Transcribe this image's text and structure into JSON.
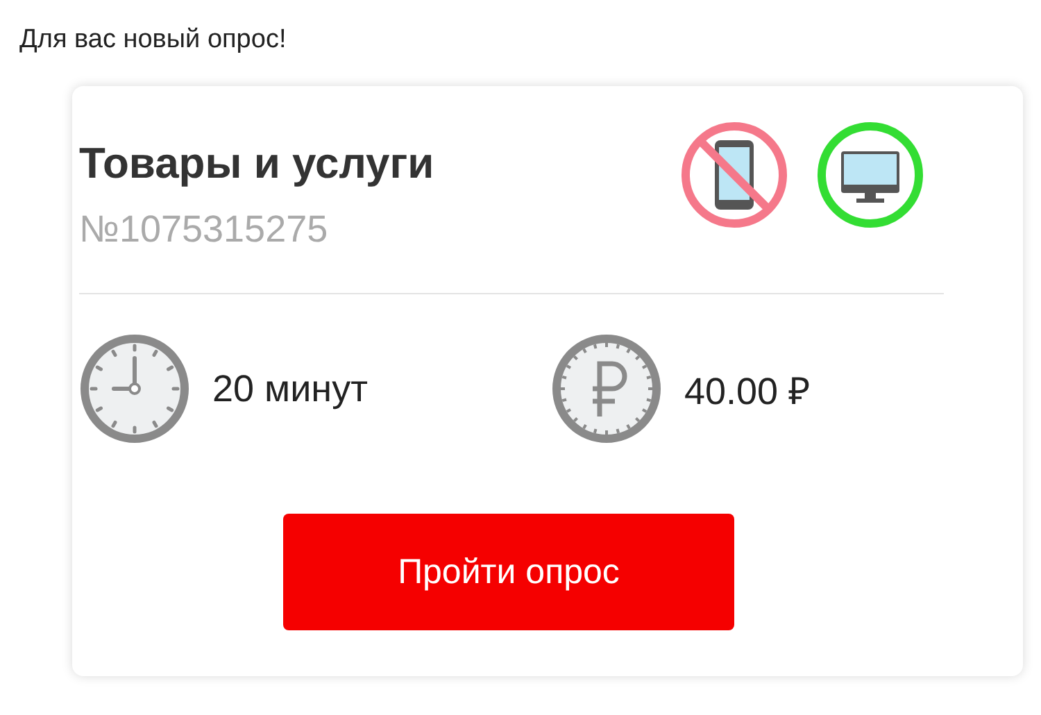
{
  "notice": "Для вас новый опрос!",
  "survey": {
    "title": "Товары и услуги",
    "number": "№1075315275",
    "devices": [
      {
        "kind": "mobile",
        "allowed": false
      },
      {
        "kind": "desktop",
        "allowed": true
      }
    ],
    "info": [
      {
        "kind": "duration",
        "text": "20 минут"
      },
      {
        "kind": "reward",
        "text": "40.00 ₽"
      }
    ],
    "button": "Пройти опрос"
  }
}
